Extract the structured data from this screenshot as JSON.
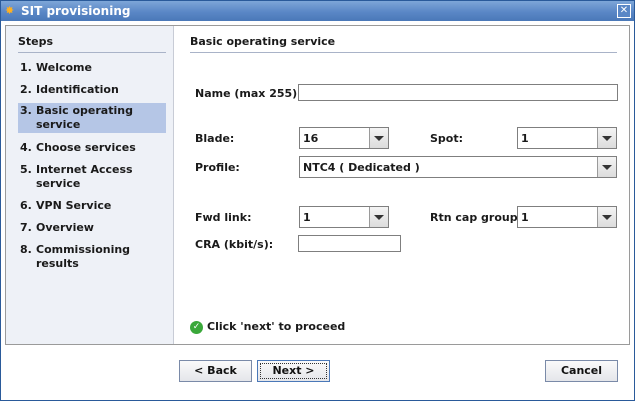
{
  "window": {
    "title": "SIT provisioning",
    "close_glyph": "✕"
  },
  "sidebar": {
    "title": "Steps",
    "steps": [
      {
        "num": "1.",
        "label": "Welcome"
      },
      {
        "num": "2.",
        "label": "Identification"
      },
      {
        "num": "3.",
        "label": "Basic operating service"
      },
      {
        "num": "4.",
        "label": "Choose services"
      },
      {
        "num": "5.",
        "label": "Internet Access service"
      },
      {
        "num": "6.",
        "label": "VPN Service"
      },
      {
        "num": "7.",
        "label": "Overview"
      },
      {
        "num": "8.",
        "label": "Commissioning results"
      }
    ],
    "active_index": 2
  },
  "main": {
    "title": "Basic operating service",
    "form": {
      "name_label": "Name (max 255):",
      "name_value": "",
      "blade_label": "Blade:",
      "blade_value": "16",
      "spot_label": "Spot:",
      "spot_value": "1",
      "profile_label": "Profile:",
      "profile_value": "NTC4  ( Dedicated )",
      "fwd_link_label": "Fwd link:",
      "fwd_link_value": "1",
      "rtn_cap_group_label": "Rtn cap group:",
      "rtn_cap_group_value": "1",
      "cra_label": "CRA (kbit/s):",
      "cra_value": ""
    },
    "hint": "Click 'next' to proceed"
  },
  "buttons": {
    "back": "< Back",
    "next": "Next >",
    "cancel": "Cancel"
  },
  "colors": {
    "titlebar": "#5a87c6",
    "active_step": "#b5c6e6",
    "ok_icon": "#3aa83a"
  }
}
